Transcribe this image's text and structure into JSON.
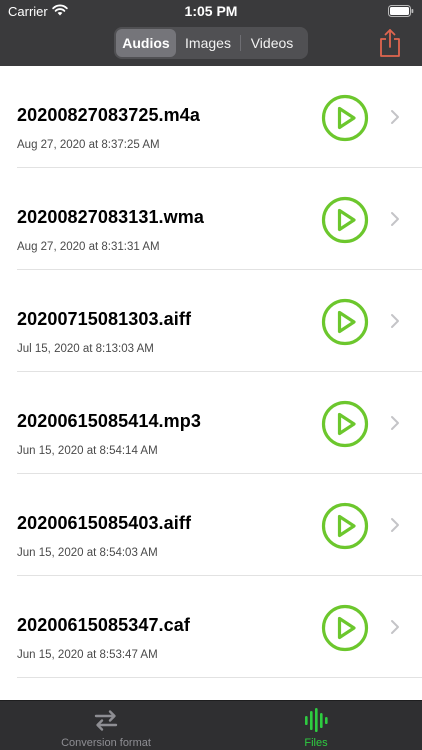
{
  "status_bar": {
    "carrier": "Carrier",
    "time": "1:05 PM"
  },
  "header": {
    "segments": [
      {
        "label": "Audios",
        "active": true
      },
      {
        "label": "Images",
        "active": false
      },
      {
        "label": "Videos",
        "active": false
      }
    ],
    "share_icon": "share-icon",
    "accent_color": "#e0654f"
  },
  "files": [
    {
      "name": "20200827083725.m4a",
      "date": "Aug 27, 2020 at 8:37:25 AM"
    },
    {
      "name": "20200827083131.wma",
      "date": "Aug 27, 2020 at 8:31:31 AM"
    },
    {
      "name": "20200715081303.aiff",
      "date": "Jul 15, 2020 at 8:13:03 AM"
    },
    {
      "name": "20200615085414.mp3",
      "date": "Jun 15, 2020 at 8:54:14 AM"
    },
    {
      "name": "20200615085403.aiff",
      "date": "Jun 15, 2020 at 8:54:03 AM"
    },
    {
      "name": "20200615085347.caf",
      "date": "Jun 15, 2020 at 8:53:47 AM"
    }
  ],
  "play_color": "#6cc72d",
  "tabbar": {
    "conversion_label": "Conversion format",
    "files_label": "Files",
    "active_color": "#2ecc40"
  }
}
